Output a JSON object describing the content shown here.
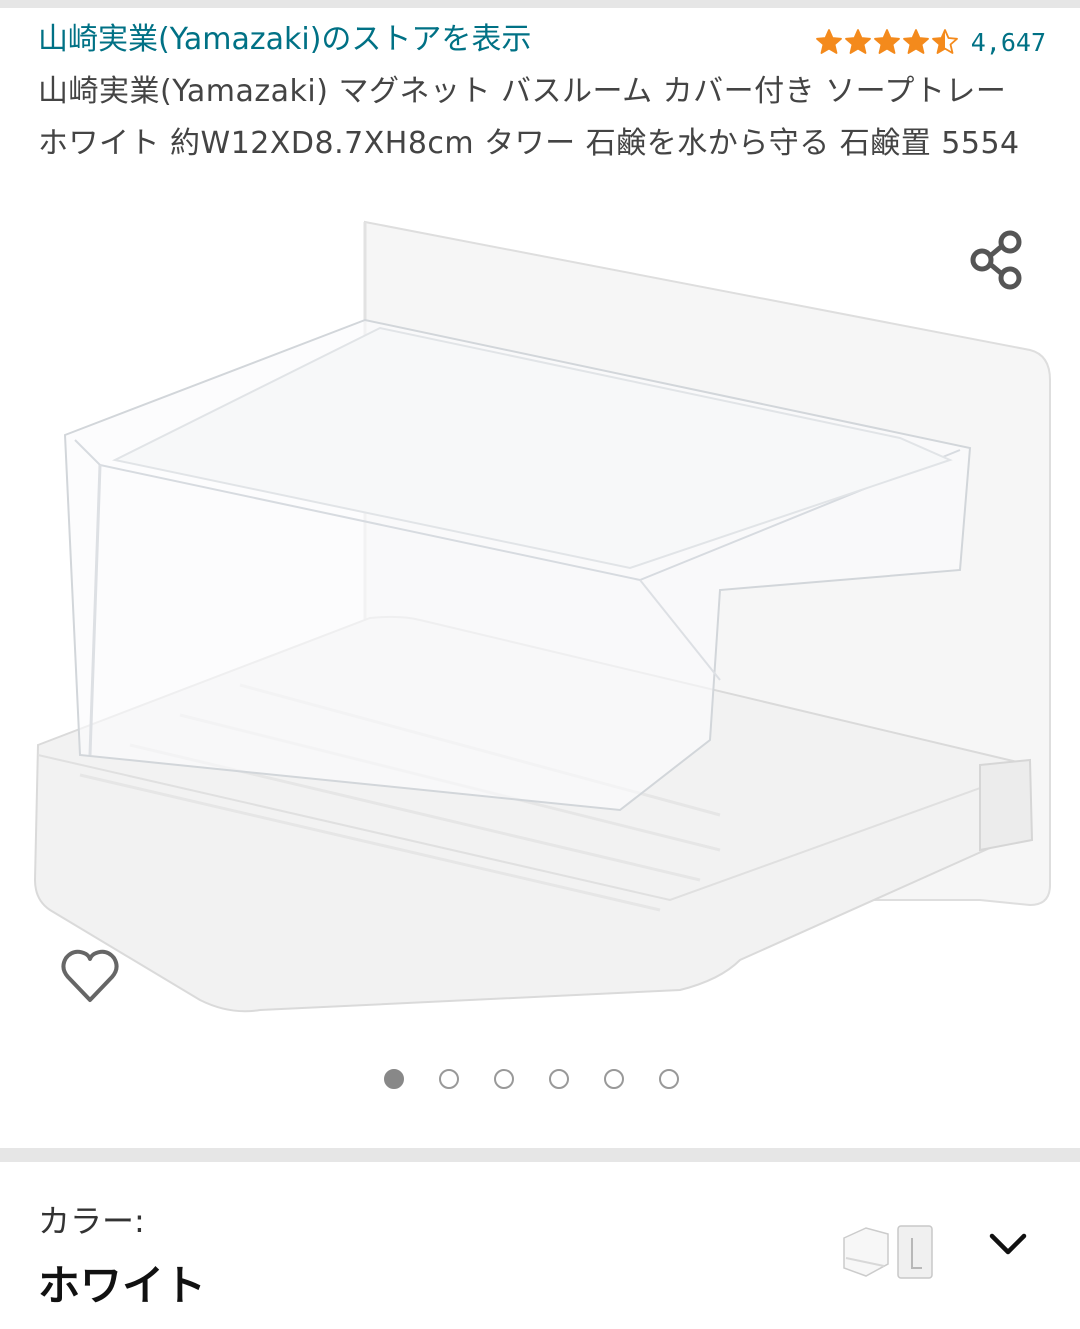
{
  "store": {
    "link_text": "山崎実業(Yamazaki)のストアを表示"
  },
  "rating": {
    "stars": 4.5,
    "count": "4,647",
    "star_color": "#f48a1c"
  },
  "product": {
    "title": "山崎実業(Yamazaki) マグネット バスルーム カバー付き ソープトレー ホワイト 約W12XD8.7XH8cm タワー 石鹸を水から守る 石鹸置 5554"
  },
  "icons": {
    "share": "share-icon",
    "favorite": "heart-icon",
    "dropdown": "chevron-down-icon"
  },
  "gallery": {
    "image_count": 6,
    "active_index": 0
  },
  "color_option": {
    "label": "カラー:",
    "value": "ホワイト"
  },
  "colors": {
    "link": "#007185",
    "divider": "#e6e6e6",
    "dot_active": "#888888"
  }
}
